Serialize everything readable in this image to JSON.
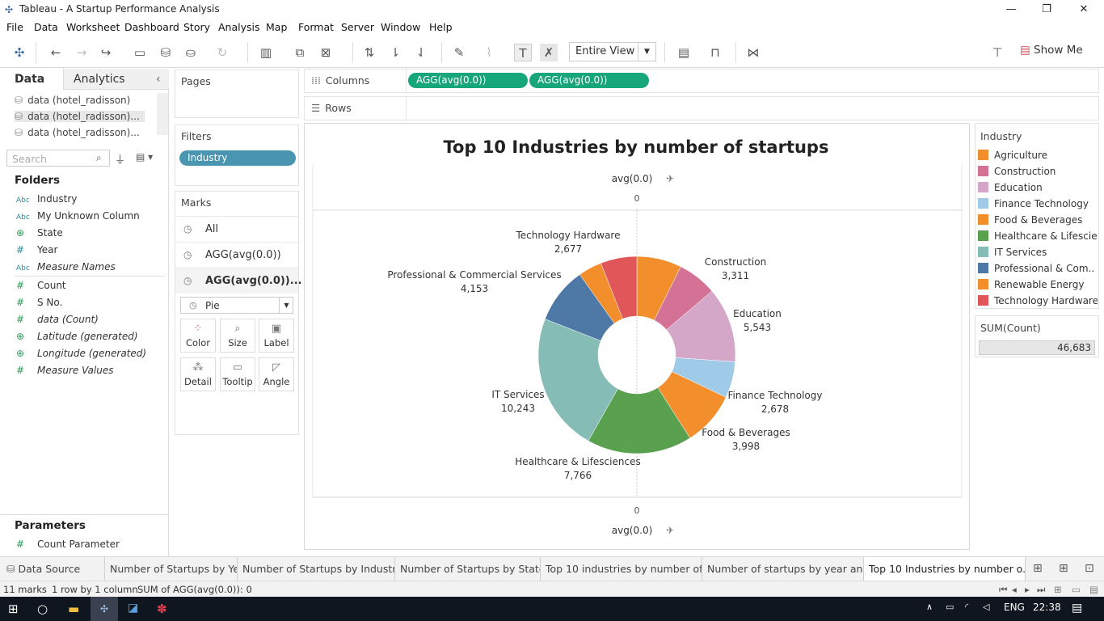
{
  "window": {
    "title": "Tableau - A Startup Performance Analysis"
  },
  "menu": [
    "File",
    "Data",
    "Worksheet",
    "Dashboard",
    "Story",
    "Analysis",
    "Map",
    "Format",
    "Server",
    "Window",
    "Help"
  ],
  "toolbar": {
    "view_select": "Entire View",
    "show_me": "Show Me"
  },
  "left_pane": {
    "tabs": {
      "data": "Data",
      "analytics": "Analytics"
    },
    "datasources": [
      "data (hotel_radisson)",
      "data (hotel_radisson)...",
      "data (hotel_radisson)..."
    ],
    "search_placeholder": "Search",
    "folders_label": "Folders",
    "fields": [
      {
        "icon": "Abc",
        "name": "Industry"
      },
      {
        "icon": "Abc",
        "name": "My Unknown Column"
      },
      {
        "icon": "globe",
        "name": "State"
      },
      {
        "icon": "#",
        "name": "Year"
      },
      {
        "icon": "Abc",
        "name": "Measure Names"
      },
      {
        "icon": "#",
        "name": "Count"
      },
      {
        "icon": "#",
        "name": "S No."
      },
      {
        "icon": "#",
        "name": "data (Count)"
      },
      {
        "icon": "globe",
        "name": "Latitude (generated)"
      },
      {
        "icon": "globe",
        "name": "Longitude (generated)"
      },
      {
        "icon": "#",
        "name": "Measure Values"
      }
    ],
    "parameters_label": "Parameters",
    "parameters": [
      "Count Parameter"
    ]
  },
  "cards": {
    "pages_label": "Pages",
    "filters_label": "Filters",
    "filter_pill": "Industry",
    "marks_label": "Marks",
    "marks_rows": [
      "All",
      "AGG(avg(0.0))",
      "AGG(avg(0.0))..."
    ],
    "mark_type": "Pie",
    "mark_buttons": [
      "Color",
      "Size",
      "Label",
      "Detail",
      "Tooltip",
      "Angle"
    ]
  },
  "shelves": {
    "columns_label": "Columns",
    "rows_label": "Rows",
    "column_pills": [
      "AGG(avg(0.0))",
      "AGG(avg(0.0))"
    ]
  },
  "viz": {
    "axis_top_label": "avg(0.0)",
    "axis_top_tick": "0",
    "axis_bottom_tick": "0",
    "axis_bottom_label": "avg(0.0)"
  },
  "chart_data": {
    "type": "pie",
    "donut": true,
    "title": "Top 10 Industries by number of startups",
    "categories": [
      "Agriculture",
      "Construction",
      "Education",
      "Finance Technology",
      "Food & Beverages",
      "Healthcare & Lifesciences",
      "IT Services",
      "Professional & Commercial Services",
      "Renewable Energy",
      "Technology Hardware"
    ],
    "slices": [
      {
        "label": "Construction",
        "value": 3311,
        "display": "3,311",
        "color": "#f28e2b"
      },
      {
        "label": "Construction",
        "value": 2900,
        "display": "",
        "color": "#d37295"
      },
      {
        "label": "Education",
        "value": 5543,
        "display": "5,543",
        "color": "#d4a6c8"
      },
      {
        "label": "Finance Technology",
        "value": 2678,
        "display": "2,678",
        "color": "#a0cbe8"
      },
      {
        "label": "Food & Beverages",
        "value": 3998,
        "display": "3,998",
        "color": "#f28e2b"
      },
      {
        "label": "Healthcare & Lifesciences",
        "value": 7766,
        "display": "7,766",
        "color": "#59a14f"
      },
      {
        "label": "IT Services",
        "value": 10243,
        "display": "10,243",
        "color": "#86bcb6"
      },
      {
        "label": "Professional & Commercial Services",
        "value": 4153,
        "display": "4,153",
        "color": "#4e79a7"
      },
      {
        "label": "",
        "value": 1750,
        "display": "",
        "color": "#f28e2b"
      },
      {
        "label": "Technology Hardware",
        "value": 2677,
        "display": "2,677",
        "color": "#e15759"
      }
    ]
  },
  "legend": {
    "title": "Industry",
    "items": [
      {
        "label": "Agriculture",
        "color": "#f28e2b"
      },
      {
        "label": "Construction",
        "color": "#d37295"
      },
      {
        "label": "Education",
        "color": "#d4a6c8"
      },
      {
        "label": "Finance Technology",
        "color": "#a0cbe8"
      },
      {
        "label": "Food & Beverages",
        "color": "#f28e2b"
      },
      {
        "label": "Healthcare & Lifescie..",
        "color": "#59a14f"
      },
      {
        "label": "IT Services",
        "color": "#86bcb6"
      },
      {
        "label": "Professional & Com..",
        "color": "#4e79a7"
      },
      {
        "label": "Renewable Energy",
        "color": "#f28e2b"
      },
      {
        "label": "Technology Hardware",
        "color": "#e15759"
      }
    ],
    "sum_title": "SUM(Count)",
    "sum_value": "46,683"
  },
  "sheet_tabs": [
    "Data Source",
    "Number of Startups by Year",
    "Number of Startups by Industry",
    "Number of Startups by State",
    "Top 10 industries by number of ...",
    "Number of startups by year and ...",
    "Top 10 Industries by number o..."
  ],
  "status": {
    "marks": "11 marks",
    "dims": "1 row by 1 column",
    "sum": "SUM of AGG(avg(0.0)): 0"
  },
  "taskbar": {
    "lang": "ENG",
    "time": "22:38"
  }
}
